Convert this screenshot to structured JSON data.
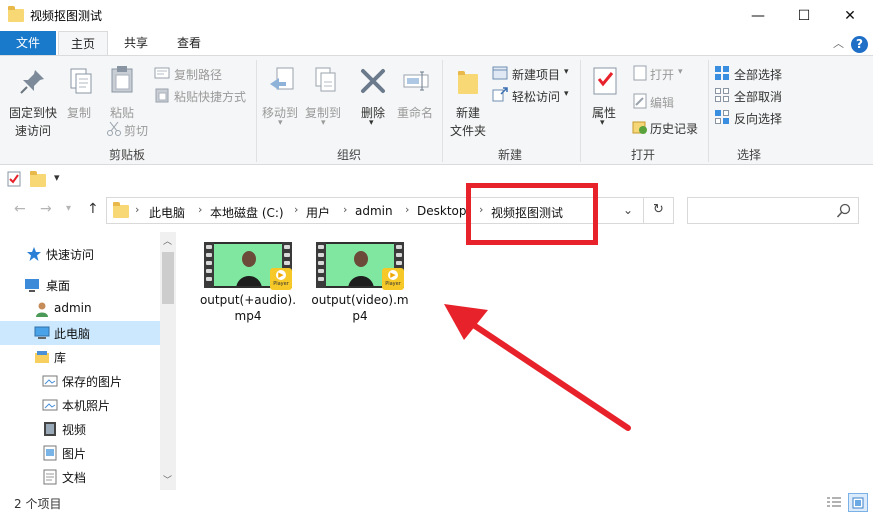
{
  "window": {
    "title": "视频抠图测试",
    "controls": {
      "minimize": "—",
      "maximize": "☐",
      "close": "✕"
    }
  },
  "ribbon_tabs": [
    "文件",
    "主页",
    "共享",
    "查看"
  ],
  "ribbon": {
    "clipboard": {
      "group": "剪贴板",
      "pin_label_1": "固定到快",
      "pin_label_2": "速访问",
      "copy": "复制",
      "paste": "粘贴",
      "copy_path": "复制路径",
      "paste_shortcut": "粘贴快捷方式",
      "cut": "剪切"
    },
    "organize": {
      "group": "组织",
      "move_to": "移动到",
      "copy_to": "复制到",
      "delete": "删除",
      "rename": "重命名"
    },
    "new": {
      "group": "新建",
      "new_folder_1": "新建",
      "new_folder_2": "文件夹",
      "new_item": "新建项目",
      "easy_access": "轻松访问"
    },
    "open": {
      "group": "打开",
      "properties": "属性",
      "open": "打开",
      "edit": "编辑",
      "history": "历史记录"
    },
    "select": {
      "group": "选择",
      "select_all": "全部选择",
      "select_none": "全部取消",
      "invert": "反向选择"
    }
  },
  "qat": {
    "dropdown": "▾"
  },
  "address": {
    "breadcrumbs": [
      "此电脑",
      "本地磁盘 (C:)",
      "用户",
      "admin",
      "Desktop",
      "视频抠图测试"
    ],
    "search_placeholder": ""
  },
  "nav_pane": {
    "items": [
      {
        "label": "快速访问",
        "icon": "star-icon"
      },
      {
        "label": "桌面",
        "icon": "desktop-icon"
      },
      {
        "label": "admin",
        "icon": "user-icon"
      },
      {
        "label": "此电脑",
        "icon": "computer-icon",
        "selected": true
      },
      {
        "label": "库",
        "icon": "library-icon"
      },
      {
        "label": "保存的图片",
        "icon": "picture-library-icon"
      },
      {
        "label": "本机照片",
        "icon": "picture-library-icon"
      },
      {
        "label": "视频",
        "icon": "video-icon"
      },
      {
        "label": "图片",
        "icon": "picture-icon"
      },
      {
        "label": "文档",
        "icon": "document-icon"
      }
    ]
  },
  "files": [
    {
      "name": "output(+audio).mp4",
      "badge": "Player"
    },
    {
      "name": "output(video).mp4",
      "badge": "Player"
    }
  ],
  "status": {
    "item_count": "2 个项目"
  },
  "colors": {
    "file_tab": "#1979ca",
    "selection": "#cce8ff",
    "annotation_red": "#e8222a"
  }
}
